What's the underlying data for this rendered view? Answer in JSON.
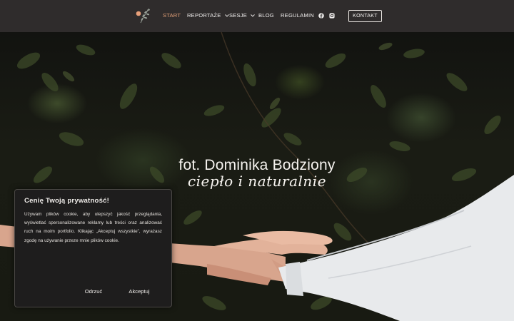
{
  "header": {
    "nav": [
      {
        "label": "START",
        "active": true,
        "has_dropdown": false
      },
      {
        "label": "REPORTAŻE",
        "active": false,
        "has_dropdown": true
      },
      {
        "label": "SESJE",
        "active": false,
        "has_dropdown": true
      },
      {
        "label": "BLOG",
        "active": false,
        "has_dropdown": false
      },
      {
        "label": "REGULAMIN",
        "active": false,
        "has_dropdown": false
      }
    ],
    "social_icons": [
      "facebook-icon",
      "instagram-icon"
    ],
    "contact_label": "KONTAKT",
    "logo_icon": "leaf-branch-icon",
    "colors": {
      "header_bg": "#2f2c2c",
      "accent": "#e6a279"
    }
  },
  "hero": {
    "title": "fot. Dominika Bodziony",
    "subtitle": "ciepło i naturalnie"
  },
  "cookie": {
    "title": "Cenię Twoją prywatność!",
    "text": "Używam plików cookie, aby ulepszyć jakość przeglądania, wyświetlać spersonalizowane reklamy lub treści oraz analizować ruch na moim portfolio. Klikając „Akceptuj wszystkie”, wyrażasz zgodę na używanie przeze mnie plików cookie.",
    "reject_label": "Odrzuć",
    "accept_label": "Akceptuj"
  }
}
